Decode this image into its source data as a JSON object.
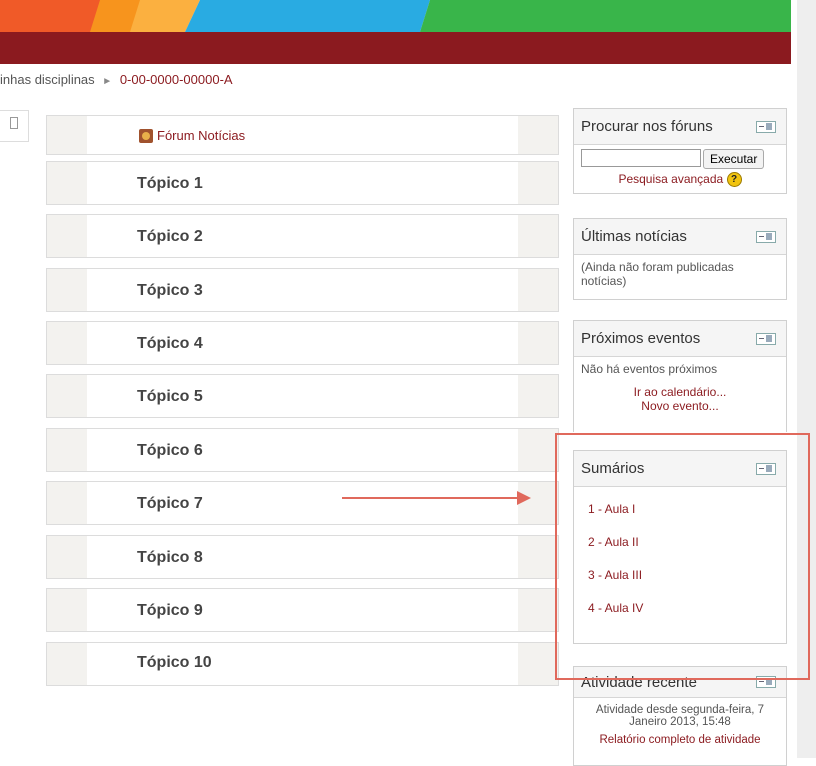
{
  "breadcrumb": {
    "parent": "inhas disciplinas",
    "separator": "►",
    "current": "0-00-0000-00000-A"
  },
  "course": {
    "forum_label": "Fórum Notícias",
    "sections": [
      "Tópico 1",
      "Tópico 2",
      "Tópico 3",
      "Tópico 4",
      "Tópico 5",
      "Tópico 6",
      "Tópico 7",
      "Tópico 8",
      "Tópico 9",
      "Tópico 10"
    ]
  },
  "blocks": {
    "search": {
      "title": "Procurar nos fóruns",
      "input_value": "",
      "button": "Executar",
      "advanced": "Pesquisa avançada",
      "help_icon": "?"
    },
    "news": {
      "title": "Últimas notícias",
      "text": "(Ainda não foram publicadas notícias)"
    },
    "events": {
      "title": "Próximos eventos",
      "text": "Não há eventos próximos",
      "link1": "Ir ao calendário...",
      "link2": "Novo evento..."
    },
    "summaries": {
      "title": "Sumários",
      "items": [
        "1 - Aula I",
        "2 - Aula II",
        "3 - Aula III",
        "4 - Aula IV"
      ]
    },
    "recent": {
      "title": "Atividade recente",
      "text": "Atividade desde segunda-feira, 7 Janeiro 2013, 15:48",
      "link": "Relatório completo de atividade"
    }
  },
  "colors": {
    "brand_red": "#8b1a1f",
    "annotation": "#e0695c"
  },
  "icons": {
    "dock": "dock-icon",
    "forum": "forum-icon",
    "help": "help-icon"
  }
}
